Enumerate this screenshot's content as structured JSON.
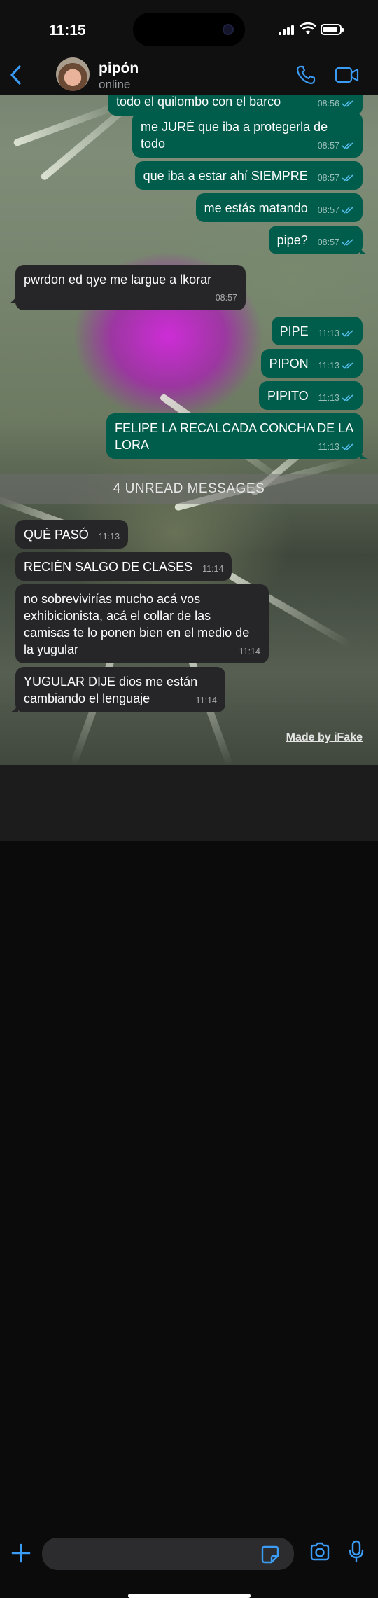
{
  "status_bar": {
    "time": "11:15"
  },
  "header": {
    "name": "pipón",
    "status": "online"
  },
  "messages": [
    {
      "dir": "out",
      "text": "todo el quilombo con el barco",
      "time": "08:56",
      "read": true
    },
    {
      "dir": "out",
      "text": "me JURÉ que iba a protegerla de todo",
      "time": "08:57",
      "read": true
    },
    {
      "dir": "out",
      "text": "que iba a estar ahí SIEMPRE",
      "time": "08:57",
      "read": true
    },
    {
      "dir": "out",
      "text": "me estás matando",
      "time": "08:57",
      "read": true
    },
    {
      "dir": "out",
      "text": "pipe?",
      "time": "08:57",
      "read": true
    },
    {
      "dir": "in",
      "text": "pwrdon ed qye me largue a lkorar",
      "time": "08:57"
    },
    {
      "dir": "out",
      "text": "PIPE",
      "time": "11:13",
      "read": true
    },
    {
      "dir": "out",
      "text": "PIPON",
      "time": "11:13",
      "read": true
    },
    {
      "dir": "out",
      "text": "PIPITO",
      "time": "11:13",
      "read": true
    },
    {
      "dir": "out",
      "text": "FELIPE LA RECALCADA CONCHA DE LA LORA",
      "time": "11:13",
      "read": true
    },
    {
      "dir": "in",
      "text": "QUÉ PASÓ",
      "time": "11:13"
    },
    {
      "dir": "in",
      "text": "RECIÉN SALGO DE CLASES",
      "time": "11:14"
    },
    {
      "dir": "in",
      "text": "no sobrevivirías mucho acá vos exhibicionista, acá el collar de las camisas te lo ponen bien en el medio de la yugular",
      "time": "11:14"
    },
    {
      "dir": "in",
      "text": "YUGULAR DIJE dios me están cambiando el lenguaje",
      "time": "11:14"
    }
  ],
  "unread_banner": "4 UNREAD MESSAGES",
  "watermark": "Made by iFake",
  "composer": {
    "placeholder": ""
  },
  "colors": {
    "accent": "#3b9cf5",
    "outgoing": "#005c4b",
    "incoming": "#262628",
    "read_ticks": "#53bdeb"
  },
  "icons": [
    "back-chevron",
    "phone",
    "video-camera",
    "plus",
    "sticker",
    "camera",
    "microphone"
  ],
  "battery_level": 0.9
}
